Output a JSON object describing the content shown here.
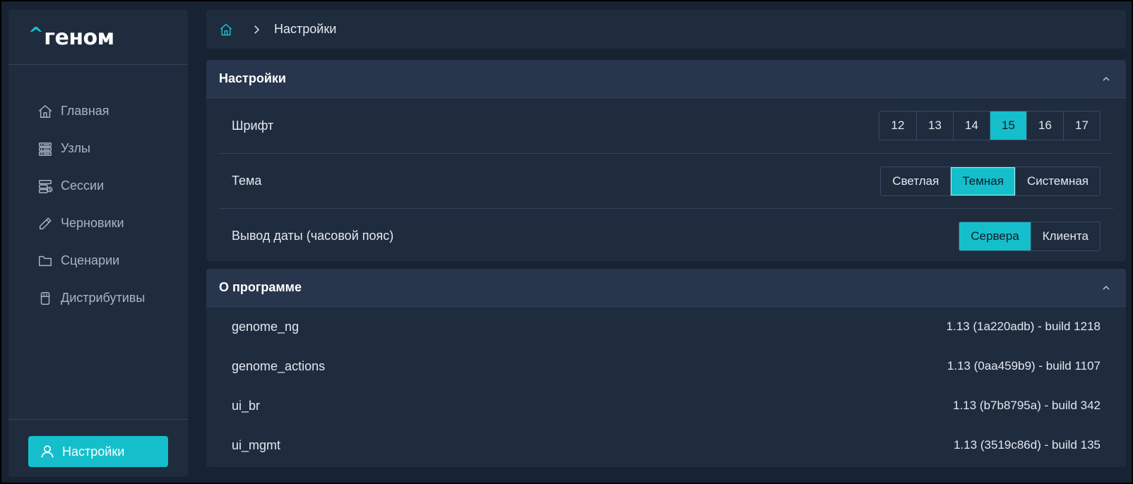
{
  "brand": {
    "logo_caret": "^",
    "logo_text": "геном"
  },
  "sidebar": {
    "items": [
      {
        "label": "Главная",
        "icon": "home-icon"
      },
      {
        "label": "Узлы",
        "icon": "server-icon"
      },
      {
        "label": "Сессии",
        "icon": "sessions-icon"
      },
      {
        "label": "Черновики",
        "icon": "pencil-icon"
      },
      {
        "label": "Сценарии",
        "icon": "folder-icon"
      },
      {
        "label": "Дистрибутивы",
        "icon": "package-icon"
      }
    ],
    "settings_button": {
      "label": "Настройки",
      "icon": "user-icon"
    }
  },
  "breadcrumb": {
    "home_icon": "home-icon",
    "current": "Настройки"
  },
  "settings_panel": {
    "title": "Настройки",
    "font": {
      "label": "Шрифт",
      "options": [
        "12",
        "13",
        "14",
        "15",
        "16",
        "17"
      ],
      "selected": "15"
    },
    "theme": {
      "label": "Тема",
      "options": [
        "Светлая",
        "Темная",
        "Системная"
      ],
      "selected": "Темная"
    },
    "date": {
      "label": "Вывод даты (часовой пояс)",
      "options": [
        "Сервера",
        "Клиента"
      ],
      "selected": "Сервера"
    }
  },
  "about_panel": {
    "title": "О программе",
    "components": [
      {
        "name": "genome_ng",
        "version": "1.13 (1a220adb) - build 1218"
      },
      {
        "name": "genome_actions",
        "version": "1.13 (0aa459b9) - build 1107"
      },
      {
        "name": "ui_br",
        "version": "1.13 (b7b8795a) - build 342"
      },
      {
        "name": "ui_mgmt",
        "version": "1.13 (3519c86d) - build 135"
      }
    ]
  },
  "colors": {
    "accent": "#14bfcb",
    "background": "#172233",
    "panel": "#1f2c3e",
    "panel_header": "#27364d"
  }
}
